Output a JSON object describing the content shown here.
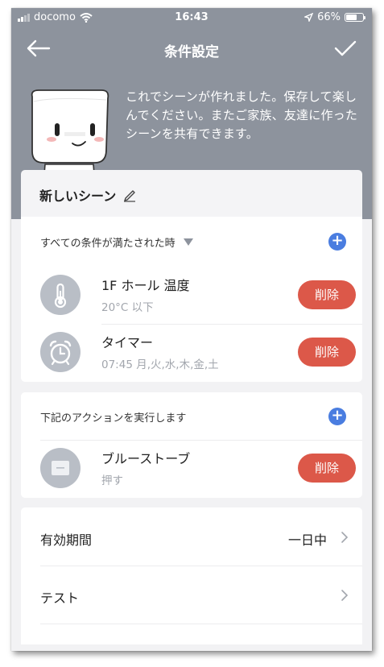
{
  "status_bar": {
    "carrier": "docomo",
    "time": "16:43",
    "battery": "66%",
    "battery_level": 0.66
  },
  "nav": {
    "title": "条件設定"
  },
  "intro": {
    "message": "これでシーンが作れました。保存して楽しんでください。またご家族、友達に作ったシーンを共有できます。"
  },
  "scene": {
    "name": "新しいシーン"
  },
  "conditions": {
    "header": "すべての条件が満たされた時",
    "items": [
      {
        "title": "1F ホール 温度",
        "detail": "20°C 以下",
        "delete_label": "削除",
        "icon": "thermometer-icon"
      },
      {
        "title": "タイマー",
        "detail": "07:45 月,火,水,木,金,土",
        "delete_label": "削除",
        "icon": "alarm-clock-icon"
      }
    ]
  },
  "actions": {
    "header": "下記のアクションを実行します",
    "items": [
      {
        "title": "ブルーストーブ",
        "detail": "押す",
        "delete_label": "削除",
        "icon": "device-icon"
      }
    ]
  },
  "settings": {
    "items": [
      {
        "label": "有効期間",
        "value": "一日中"
      },
      {
        "label": "テスト",
        "value": ""
      }
    ]
  },
  "colors": {
    "header_bg": "#8d939d",
    "accent_blue": "#4a7de0",
    "delete_red": "#dc5849",
    "icon_grey": "#b9bec6"
  }
}
